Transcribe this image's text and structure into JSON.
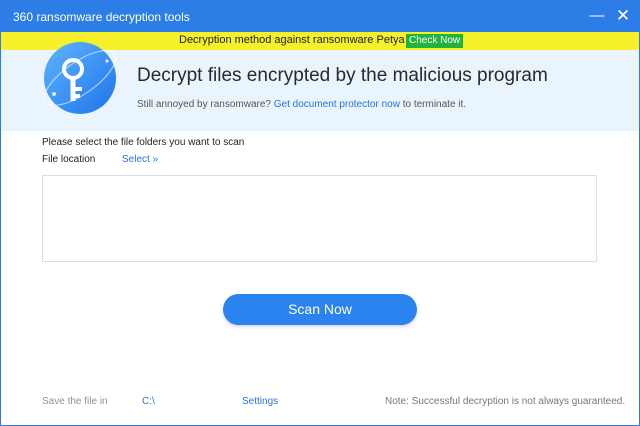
{
  "titlebar": {
    "title": "360 ransomware decryption tools",
    "minimize_label": "—",
    "close_label": "✕"
  },
  "banner": {
    "message": "Decryption method against ransomware Petya",
    "button_label": "Check Now",
    "background_color": "#f6f02a",
    "button_color": "#21b33c"
  },
  "header": {
    "icon": "key-logo-icon",
    "title": "Decrypt files encrypted by the malicious program",
    "subtitle_prefix": "Still annoyed by ransomware? ",
    "subtitle_link": "Get document protector now",
    "subtitle_suffix": " to terminate it."
  },
  "form": {
    "instruction": "Please select the file folders you want to scan",
    "location_label": "File location",
    "select_label": "Select »"
  },
  "actions": {
    "scan_label": "Scan Now",
    "accent_color": "#2a83ef"
  },
  "footer": {
    "save_label": "Save the file in",
    "save_path": "C:\\",
    "settings_label": "Settings",
    "note": "Note: Successful decryption is not always guaranteed."
  }
}
